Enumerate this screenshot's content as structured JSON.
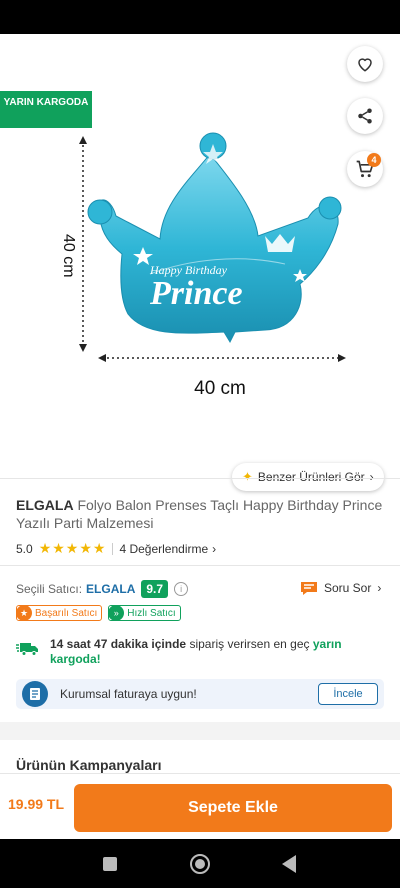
{
  "hero": {
    "cargo_badge": "YARIN KARGODA",
    "cart_count": "4",
    "similar_label": "Benzer Ürünleri Gör",
    "image": {
      "height_label": "40 cm",
      "width_label": "40 cm",
      "balloon_text_top": "Happy Birthday",
      "balloon_text_main": "Prince",
      "balloon_color": "#2fb6d6"
    }
  },
  "product": {
    "brand": "ELGALA",
    "title": "Folyo Balon Prenses Taçlı Happy Birthday Prince Yazılı Parti Malzemesi",
    "rating": "5.0",
    "stars": "★★★★★",
    "reviews": "4 Değerlendirme"
  },
  "seller": {
    "label": "Seçili Satıcı:",
    "name": "ELGALA",
    "score": "9.7",
    "question_label": "Soru Sor",
    "badges": [
      "Başarılı Satıcı",
      "Hızlı Satıcı"
    ]
  },
  "delivery": {
    "time": "14 saat 47 dakika içinde",
    "middle": "sipariş verirsen en geç",
    "highlight": "yarın kargoda!"
  },
  "invoice": {
    "text": "Kurumsal faturaya uygun!",
    "button": "İncele"
  },
  "campaigns": {
    "title": "Ürünün Kampanyaları"
  },
  "bottom": {
    "price": "19.99 TL",
    "add_to_cart": "Sepete Ekle"
  },
  "colors": {
    "accent": "#f27a1a",
    "green": "#10a15c",
    "link": "#1e6ea7"
  }
}
